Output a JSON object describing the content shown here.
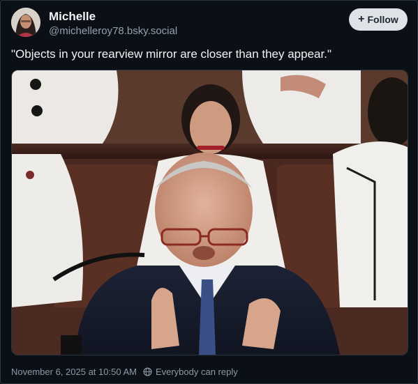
{
  "author": {
    "display_name": "Michelle",
    "handle": "@michelleroy78.bsky.social",
    "avatar_icon": "avatar-photo"
  },
  "follow_button": {
    "label": "Follow",
    "icon": "plus-icon"
  },
  "post": {
    "text": "\"Objects in your rearview mirror are closer than they appear.\"",
    "image_icon": "photo"
  },
  "footer": {
    "timestamp": "November 6, 2025 at 10:50 AM",
    "reply_setting": "Everybody can reply",
    "reply_icon": "globe-icon"
  },
  "colors": {
    "background": "#0b1016",
    "text": "#f1f3f5",
    "muted": "#8c99a6",
    "button_bg": "#dfe3e8"
  }
}
